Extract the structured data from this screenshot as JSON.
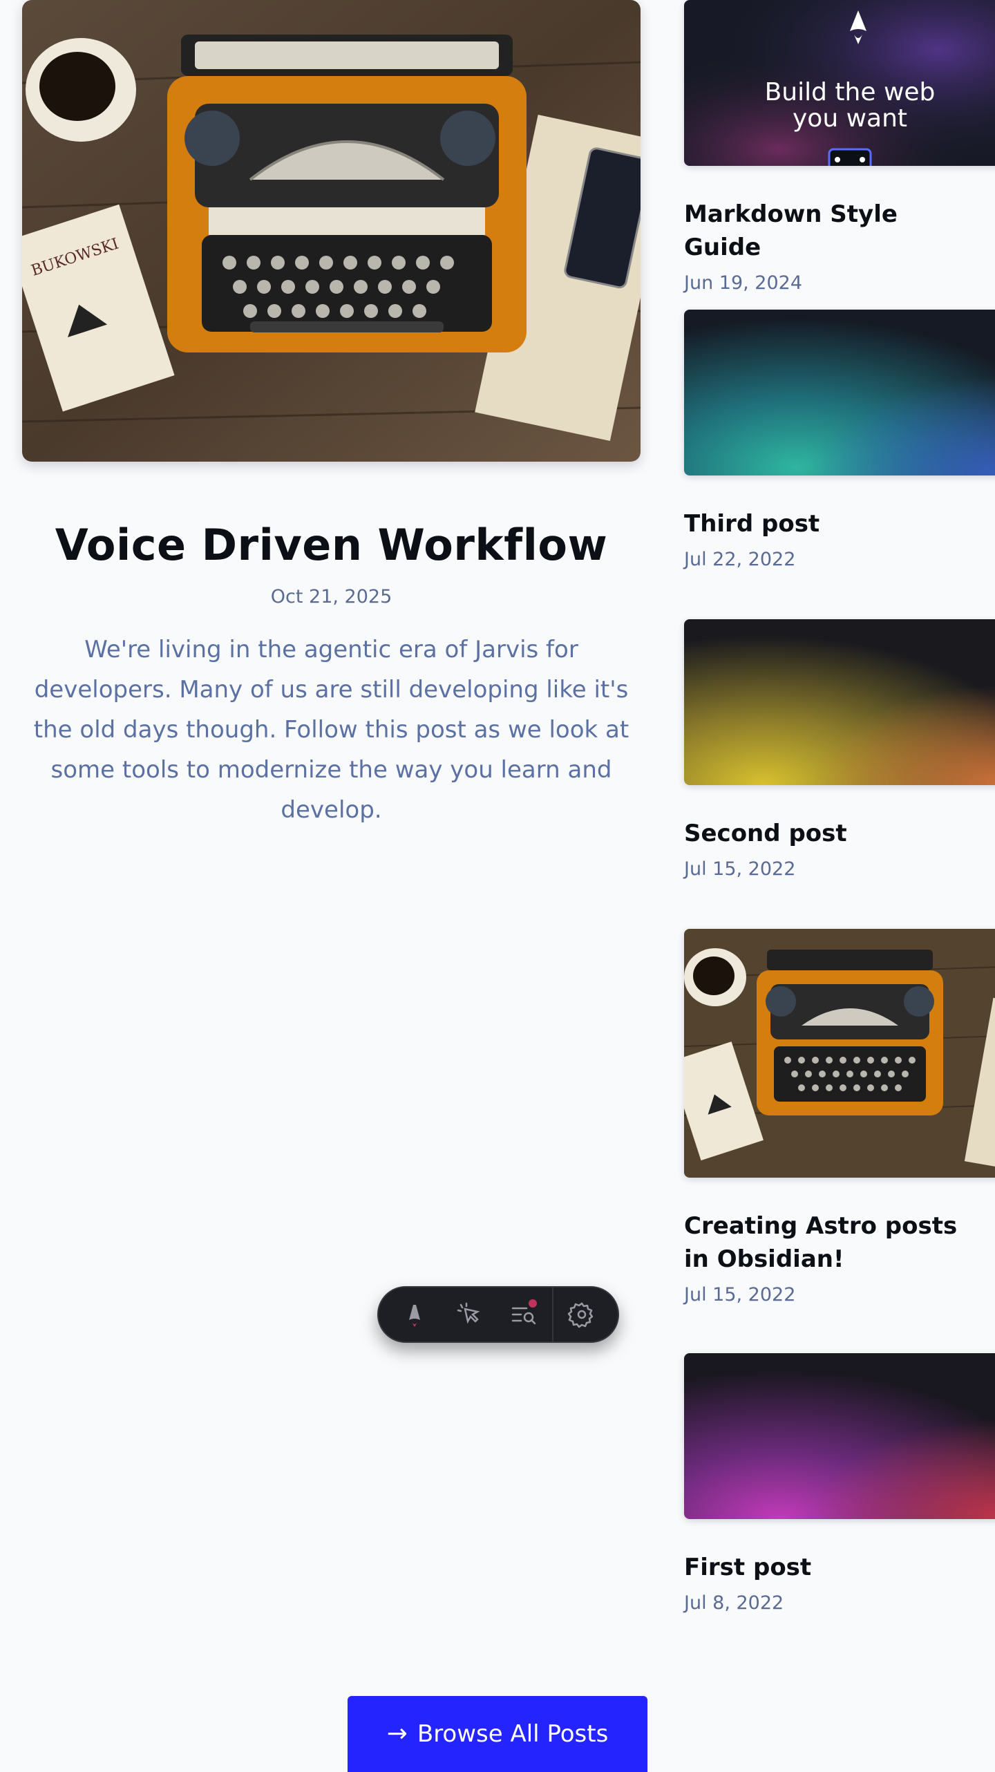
{
  "featured": {
    "title": "Voice Driven Workflow",
    "date": "Oct 21, 2025",
    "description": "We're living in the agentic era of Jarvis for developers. Many of us are still developing like it's the old days though. Follow this post as we look at some tools to modernize the way you learn and develop.",
    "image_icon": "typewriter-photo"
  },
  "posts": [
    {
      "title": "Markdown Style Guide",
      "date": "Jun 19, 2024",
      "thumbnail": "astro-banner",
      "thumbnail_text": "Build the web you want"
    },
    {
      "title": "Third post",
      "date": "Jul 22, 2022",
      "thumbnail": "gradient-teal"
    },
    {
      "title": "Second post",
      "date": "Jul 15, 2022",
      "thumbnail": "gradient-gold"
    },
    {
      "title": "Creating Astro posts in Obsidian!",
      "date": "Jul 15, 2022",
      "thumbnail": "typewriter-photo"
    },
    {
      "title": "First post",
      "date": "Jul 8, 2022",
      "thumbnail": "gradient-magenta"
    }
  ],
  "dev_toolbar": {
    "apps": [
      "astro-logo-icon",
      "inspect-cursor-icon",
      "audit-list-icon",
      "settings-gear-icon"
    ]
  },
  "browse": {
    "label": "Browse All Posts",
    "icon": "arrow-right-icon"
  },
  "colors": {
    "accent": "#2424ff",
    "title": "#0d0f17",
    "date": "#5a6b93",
    "description": "#5b70a3",
    "toolbar_bg": "#1e1f25"
  }
}
